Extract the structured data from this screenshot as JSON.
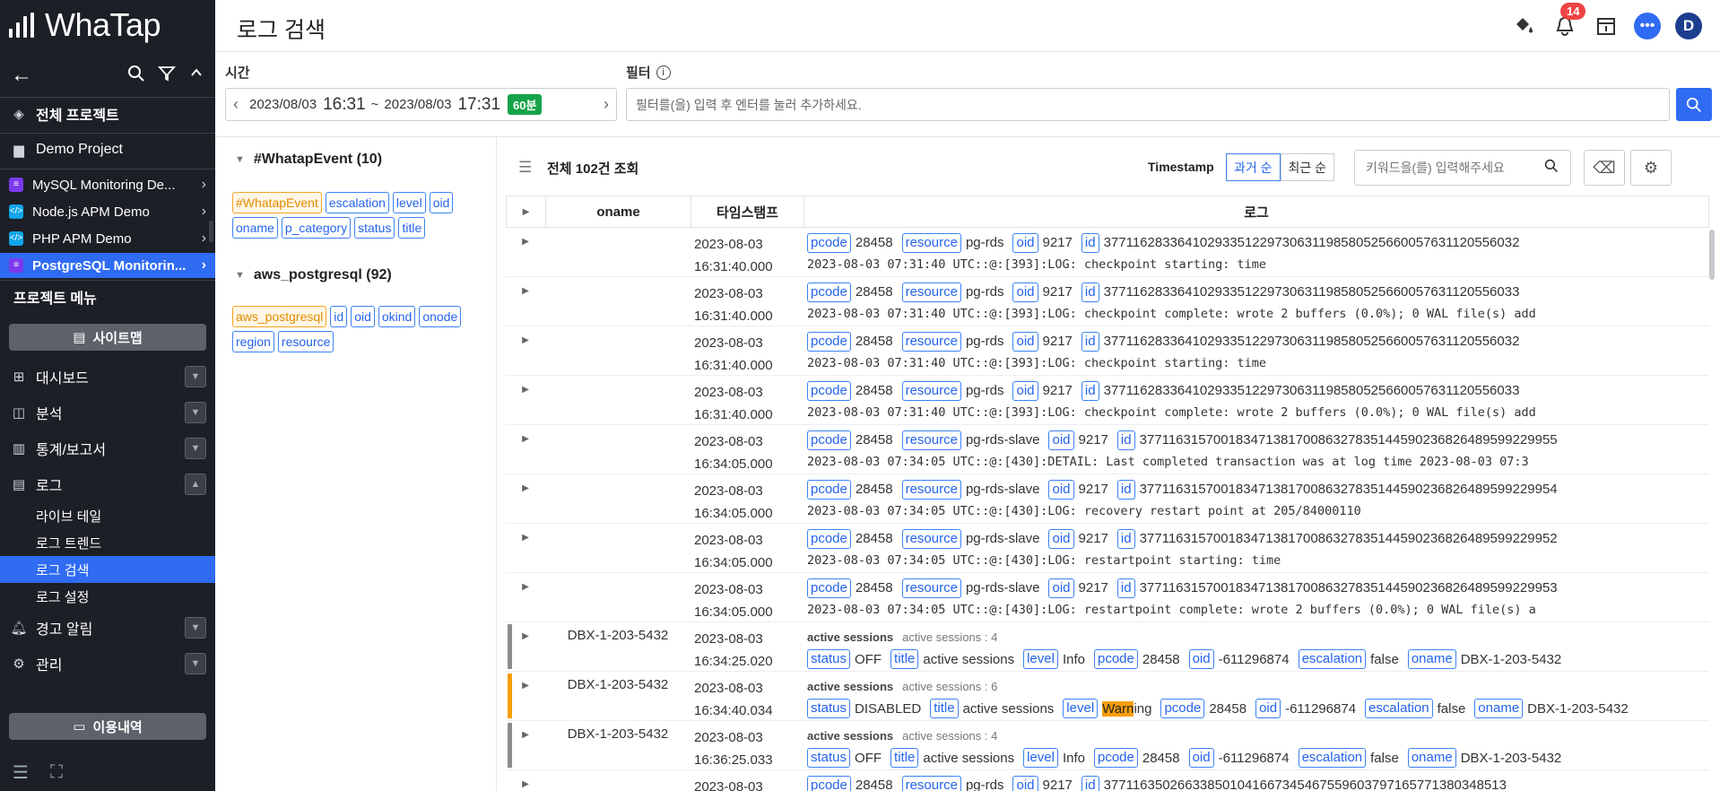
{
  "app": {
    "brand": "WhaTap",
    "page_title": "로그 검색"
  },
  "header": {
    "notification_count": "14",
    "avatar_letter": "D"
  },
  "sidebar": {
    "all_projects": "전체 프로젝트",
    "demo_project": "Demo Project",
    "projects": [
      {
        "label": "MySQL Monitoring De..."
      },
      {
        "label": "Node.js APM Demo"
      },
      {
        "label": "PHP APM Demo"
      },
      {
        "label": "PostgreSQL Monitorin..."
      }
    ],
    "project_menu": "프로젝트 메뉴",
    "sitemap_button": "사이트맵",
    "menus": [
      {
        "label": "대시보드"
      },
      {
        "label": "분석"
      },
      {
        "label": "통계/보고서"
      },
      {
        "label": "로그"
      }
    ],
    "log_submenu": [
      {
        "label": "라이브 테일"
      },
      {
        "label": "로그 트렌드"
      },
      {
        "label": "로그 검색"
      },
      {
        "label": "로그 설정"
      }
    ],
    "alert_menu": "경고 알림",
    "admin_menu": "관리",
    "usage_button": "이용내역"
  },
  "filter_bar": {
    "time_label": "시간",
    "filter_label": "필터",
    "time_start_date": "2023/08/03",
    "time_start_hm": "16:31",
    "time_sep": "~",
    "time_end_date": "2023/08/03",
    "time_end_hm": "17:31",
    "duration": "60분",
    "filter_placeholder": "필터를(을) 입력 후 엔터를 눌러 추가하세요."
  },
  "fields": {
    "group1": {
      "title": "#WhatapEvent (10)",
      "chips": [
        "#WhatapEvent",
        "escalation",
        "level",
        "oid",
        "oname",
        "p_category",
        "status",
        "title"
      ]
    },
    "group2": {
      "title": "aws_postgresql (92)",
      "chips": [
        "aws_postgresql",
        "id",
        "oid",
        "okind",
        "onode",
        "region",
        "resource"
      ]
    }
  },
  "results": {
    "count_label": "전체 102건 조회",
    "timestamp_label": "Timestamp",
    "sort_past": "과거 순",
    "sort_recent": "최근 순",
    "keyword_placeholder": "키워드을(를) 입력해주세요",
    "columns": {
      "oname": "oname",
      "timestamp": "타임스탬프",
      "log": "로그"
    }
  },
  "colors": {
    "accent": "#2f6bf3",
    "info_bar": "#8c8c8c",
    "warning_bar": "#f59e0b"
  },
  "rows": [
    {
      "oname": "",
      "date": "2023-08-03",
      "time": "16:31:40.000",
      "resource": "pg-rds",
      "id": "377116283364102933512297306311985805256600576311205560​32",
      "msg": "2023-08-03 07:31:40 UTC::@:[393]:LOG:  checkpoint starting: time"
    },
    {
      "oname": "",
      "date": "2023-08-03",
      "time": "16:31:40.000",
      "resource": "pg-rds",
      "id": "37711628336410293351229730631198580525660057631120556033",
      "msg": "2023-08-03 07:31:40 UTC::@:[393]:LOG:  checkpoint complete: wrote 2 buffers (0.0%); 0 WAL file(s) add"
    },
    {
      "oname": "",
      "date": "2023-08-03",
      "time": "16:31:40.000",
      "resource": "pg-rds",
      "id": "37711628336410293351229730631198580525660057631120556032",
      "msg": "2023-08-03 07:31:40 UTC::@:[393]:LOG:  checkpoint starting: time"
    },
    {
      "oname": "",
      "date": "2023-08-03",
      "time": "16:31:40.000",
      "resource": "pg-rds",
      "id": "37711628336410293351229730631198580525660057631120556033",
      "msg": "2023-08-03 07:31:40 UTC::@:[393]:LOG:  checkpoint complete: wrote 2 buffers (0.0%); 0 WAL file(s) add"
    },
    {
      "oname": "",
      "date": "2023-08-03",
      "time": "16:34:05.000",
      "resource": "pg-rds-slave",
      "id": "37711631570018347138170086327835144590236826489599229955",
      "msg": "2023-08-03 07:34:05 UTC::@:[430]:DETAIL:  Last completed transaction was at log time 2023-08-03 07:3"
    },
    {
      "oname": "",
      "date": "2023-08-03",
      "time": "16:34:05.000",
      "resource": "pg-rds-slave",
      "id": "37711631570018347138170086327835144590236826489599229954",
      "msg": "2023-08-03 07:34:05 UTC::@:[430]:LOG:  recovery restart point at 205/84000110"
    },
    {
      "oname": "",
      "date": "2023-08-03",
      "time": "16:34:05.000",
      "resource": "pg-rds-slave",
      "id": "37711631570018347138170086327835144590236826489599229952",
      "msg": "2023-08-03 07:34:05 UTC::@:[430]:LOG:  restartpoint starting: time"
    },
    {
      "oname": "",
      "date": "2023-08-03",
      "time": "16:34:05.000",
      "resource": "pg-rds-slave",
      "id": "37711631570018347138170086327835144590236826489599229953",
      "msg": "2023-08-03 07:34:05 UTC::@:[430]:LOG:  restartpoint complete: wrote 2 buffers (0.0%); 0 WAL file(s) a"
    }
  ],
  "event_rows": [
    {
      "oname": "DBX-1-203-5432",
      "date": "2023-08-03",
      "time": "16:34:25.020",
      "title": "active sessions",
      "message": "active sessions : 4",
      "status": "OFF",
      "level_pre": "Info",
      "level_hl": "",
      "level_post": "",
      "pcode": "28458",
      "oid": "-611296874",
      "escalation": "false"
    },
    {
      "oname": "DBX-1-203-5432",
      "date": "2023-08-03",
      "time": "16:34:40.034",
      "title": "active sessions",
      "message": "active sessions : 6",
      "status": "DISABLED",
      "level_pre": "",
      "level_hl": "Warn",
      "level_post": "ing",
      "pcode": "28458",
      "oid": "-611296874",
      "escalation": "false"
    },
    {
      "oname": "DBX-1-203-5432",
      "date": "2023-08-03",
      "time": "16:36:25.033",
      "title": "active sessions",
      "message": "active sessions : 4",
      "status": "OFF",
      "level_pre": "Info",
      "level_hl": "",
      "level_post": "",
      "pcode": "28458",
      "oid": "-611296874",
      "escalation": "false"
    }
  ],
  "partial_row": {
    "date": "2023-08-03",
    "pcode": "28458",
    "resource": "pg-rds",
    "oid": "9217",
    "id": "37711635026633850104166734546755960379716577138034851​3"
  },
  "common": {
    "pcode": "28458",
    "oid": "9217",
    "tag_pcode": "pcode",
    "tag_resource": "resource",
    "tag_oid": "oid",
    "tag_id": "id",
    "tag_status": "status",
    "tag_title": "title",
    "tag_level": "level",
    "tag_escalation": "escalation",
    "tag_oname": "oname"
  }
}
